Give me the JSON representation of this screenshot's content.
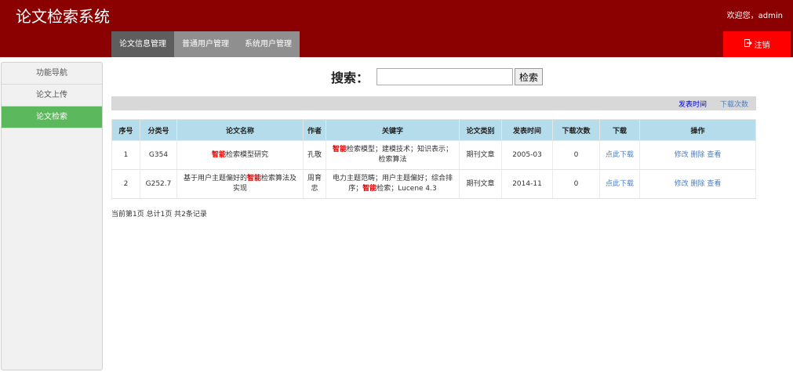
{
  "header": {
    "app_title": "论文检索系统",
    "welcome": "欢迎您，admin",
    "logout_label": "注销",
    "logout_icon": "logout-icon"
  },
  "nav": {
    "tabs": [
      {
        "label": "论文信息管理",
        "active": true
      },
      {
        "label": "普通用户管理",
        "active": false
      },
      {
        "label": "系统用户管理",
        "active": false
      }
    ]
  },
  "sidebar": {
    "items": [
      {
        "label": "功能导航"
      },
      {
        "label": "论文上传"
      },
      {
        "label": "论文检索",
        "active": true
      }
    ]
  },
  "search": {
    "label": "搜索：",
    "value": "",
    "placeholder": "",
    "button_label": "检索"
  },
  "sort": {
    "by_time": "发表时间",
    "by_downloads": "下载次数"
  },
  "table": {
    "headers": [
      "序号",
      "分类号",
      "论文名称",
      "作者",
      "关键字",
      "论文类别",
      "发表时间",
      "下载次数",
      "下载",
      "操作"
    ],
    "rows": [
      {
        "no": "1",
        "class_no": "G354",
        "title_hl": "智能",
        "title_rest": "检索模型研究",
        "author": "孔敬",
        "kw_hl": "智能",
        "kw_rest": "检索模型；建模技术；知识表示；检索算法",
        "category": "期刊文章",
        "date": "2005-03",
        "downloads": "0",
        "download_link": "点此下载",
        "edit": "修改",
        "delete": "删除",
        "view": "查看"
      },
      {
        "no": "2",
        "class_no": "G252.7",
        "title_pre": "基于用户主题偏好的",
        "title_hl": "智能",
        "title_rest": "检索算法及实现",
        "author": "周育忠",
        "kw_pre": "电力主题范畴；用户主题偏好；综合排序；",
        "kw_hl": "智能",
        "kw_rest": "检索；Lucene 4.3",
        "category": "期刊文章",
        "date": "2014-11",
        "downloads": "0",
        "download_link": "点此下载",
        "edit": "修改",
        "delete": "删除",
        "view": "查看"
      }
    ]
  },
  "pagination": {
    "info": "当前第1页 总计1页 共2条记录"
  },
  "colors": {
    "header_bg": "#8b0000",
    "logout_bg": "#ff0000",
    "active_side": "#5cb85c",
    "table_header": "#b4dcea",
    "highlight": "#e00000"
  }
}
